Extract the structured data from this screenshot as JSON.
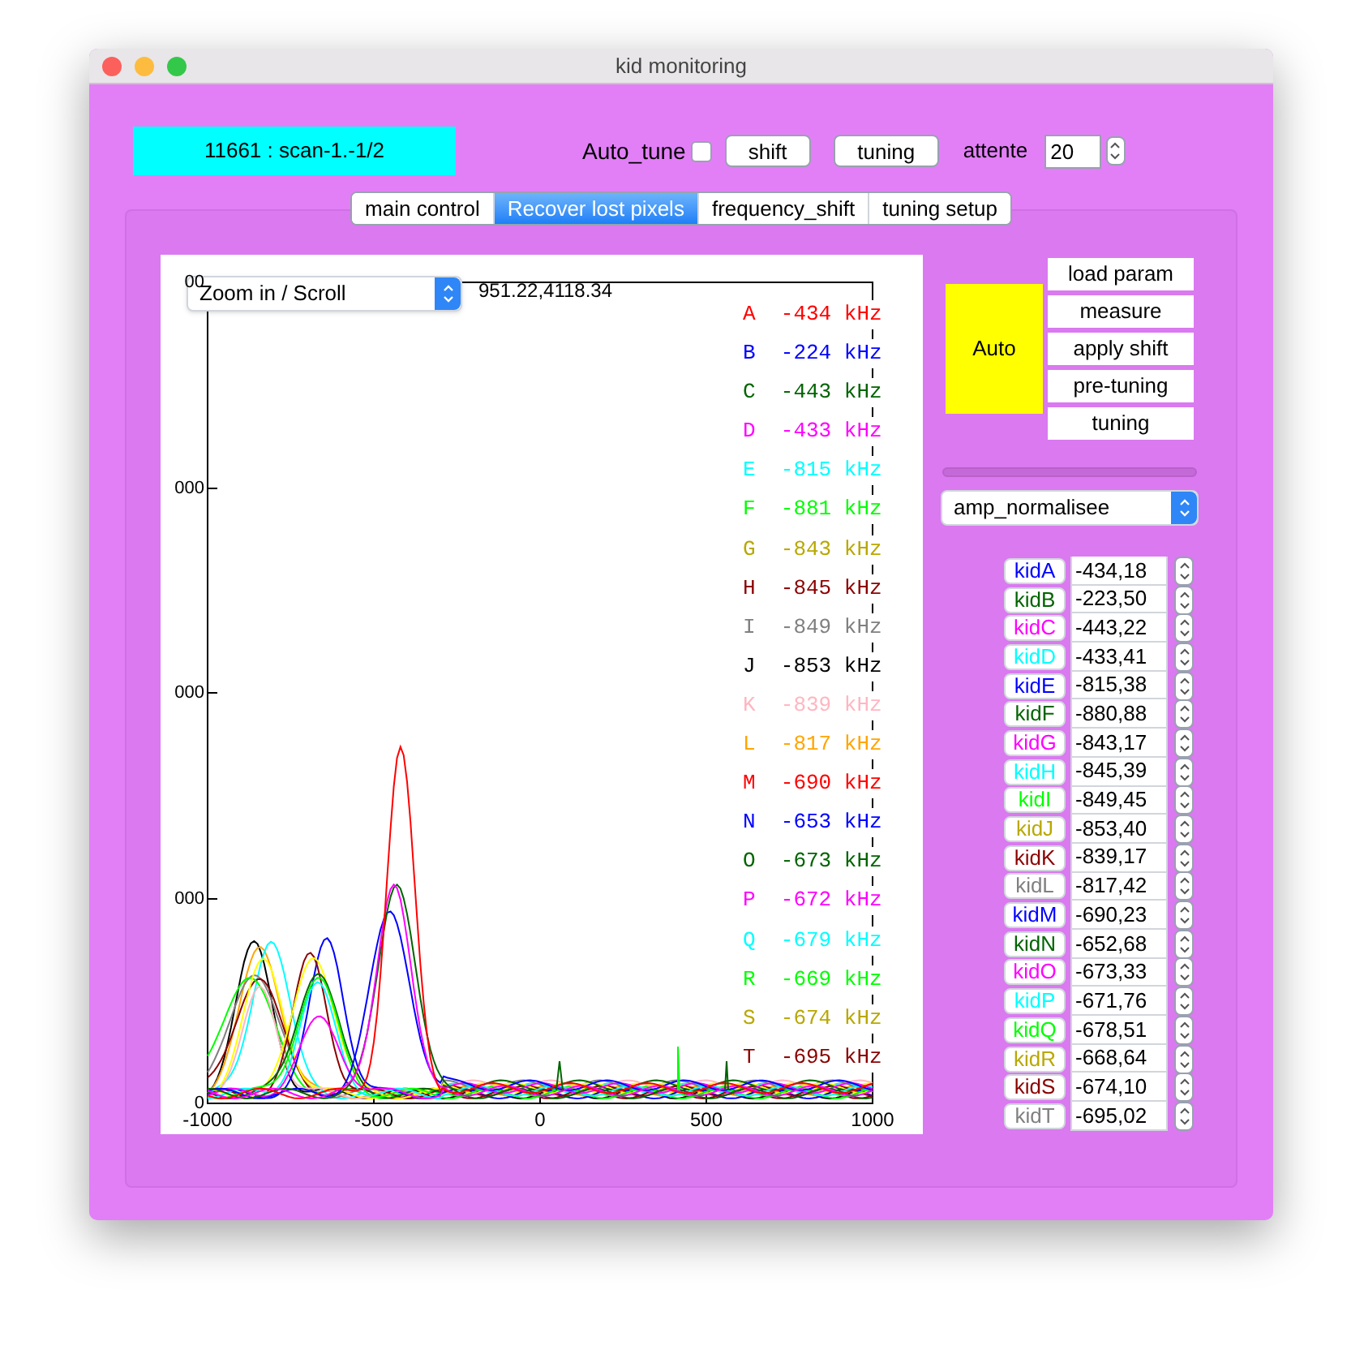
{
  "window": {
    "title": "kid monitoring"
  },
  "header": {
    "scan_label": "11661 : scan-1.-1/2",
    "auto_tune": {
      "label": "Auto_tune",
      "checked": false
    },
    "buttons": [
      "shift",
      "tuning"
    ],
    "attente": {
      "label": "attente",
      "value": "20"
    }
  },
  "tabs": [
    {
      "label": "main control",
      "selected": false
    },
    {
      "label": "Recover lost pixels",
      "selected": true
    },
    {
      "label": "frequency_shift",
      "selected": false
    },
    {
      "label": "tuning setup",
      "selected": false
    }
  ],
  "plot": {
    "mode_dropdown": "Zoom in / Scroll",
    "cursor_readout": "951.22,4118.34",
    "y_tick_labels": [
      "00",
      "000",
      "000",
      "000",
      "0"
    ],
    "x_tick_labels": [
      "-1000",
      "-500",
      "0",
      "500",
      "1000"
    ],
    "legend": [
      {
        "letter": "A",
        "value": "-434",
        "unit": "kHz",
        "color": "#ff0000"
      },
      {
        "letter": "B",
        "value": "-224",
        "unit": "kHz",
        "color": "#0000ff"
      },
      {
        "letter": "C",
        "value": "-443",
        "unit": "kHz",
        "color": "#006400"
      },
      {
        "letter": "D",
        "value": "-433",
        "unit": "kHz",
        "color": "#ff00ff"
      },
      {
        "letter": "E",
        "value": "-815",
        "unit": "kHz",
        "color": "#00ffff"
      },
      {
        "letter": "F",
        "value": "-881",
        "unit": "kHz",
        "color": "#00ff00"
      },
      {
        "letter": "G",
        "value": "-843",
        "unit": "kHz",
        "color": "#b8a800"
      },
      {
        "letter": "H",
        "value": "-845",
        "unit": "kHz",
        "color": "#8b0000"
      },
      {
        "letter": "I",
        "value": "-849",
        "unit": "kHz",
        "color": "#808080"
      },
      {
        "letter": "J",
        "value": "-853",
        "unit": "kHz",
        "color": "#000000"
      },
      {
        "letter": "K",
        "value": "-839",
        "unit": "kHz",
        "color": "#ffb6c1"
      },
      {
        "letter": "L",
        "value": "-817",
        "unit": "kHz",
        "color": "#ffa500"
      },
      {
        "letter": "M",
        "value": "-690",
        "unit": "kHz",
        "color": "#ff0000"
      },
      {
        "letter": "N",
        "value": "-653",
        "unit": "kHz",
        "color": "#0000ff"
      },
      {
        "letter": "O",
        "value": "-673",
        "unit": "kHz",
        "color": "#006400"
      },
      {
        "letter": "P",
        "value": "-672",
        "unit": "kHz",
        "color": "#ff00ff"
      },
      {
        "letter": "Q",
        "value": "-679",
        "unit": "kHz",
        "color": "#00ffff"
      },
      {
        "letter": "R",
        "value": "-669",
        "unit": "kHz",
        "color": "#00ff00"
      },
      {
        "letter": "S",
        "value": "-674",
        "unit": "kHz",
        "color": "#b8a800"
      },
      {
        "letter": "T",
        "value": "-695",
        "unit": "kHz",
        "color": "#8b0000"
      }
    ]
  },
  "controls": {
    "auto_button": "Auto",
    "buttons": [
      "load param",
      "measure",
      "apply shift",
      "pre-tuning",
      "tuning"
    ],
    "progress": {
      "level": 0
    },
    "mode_select": "amp_normalisee"
  },
  "kids": [
    {
      "label": "kidA",
      "value": "-434,18",
      "color": "#0000ff"
    },
    {
      "label": "kidB",
      "value": "-223,50",
      "color": "#006400"
    },
    {
      "label": "kidC",
      "value": "-443,22",
      "color": "#ff00ff"
    },
    {
      "label": "kidD",
      "value": "-433,41",
      "color": "#00ffff"
    },
    {
      "label": "kidE",
      "value": "-815,38",
      "color": "#0000ff"
    },
    {
      "label": "kidF",
      "value": "-880,88",
      "color": "#006400"
    },
    {
      "label": "kidG",
      "value": "-843,17",
      "color": "#ff00ff"
    },
    {
      "label": "kidH",
      "value": "-845,39",
      "color": "#00ffff"
    },
    {
      "label": "kidI",
      "value": "-849,45",
      "color": "#00ff00"
    },
    {
      "label": "kidJ",
      "value": "-853,40",
      "color": "#b8a800"
    },
    {
      "label": "kidK",
      "value": "-839,17",
      "color": "#8b0000"
    },
    {
      "label": "kidL",
      "value": "-817,42",
      "color": "#808080"
    },
    {
      "label": "kidM",
      "value": "-690,23",
      "color": "#0000ff"
    },
    {
      "label": "kidN",
      "value": "-652,68",
      "color": "#006400"
    },
    {
      "label": "kidO",
      "value": "-673,33",
      "color": "#ff00ff"
    },
    {
      "label": "kidP",
      "value": "-671,76",
      "color": "#00ffff"
    },
    {
      "label": "kidQ",
      "value": "-678,51",
      "color": "#00ff00"
    },
    {
      "label": "kidR",
      "value": "-668,64",
      "color": "#b8a800"
    },
    {
      "label": "kidS",
      "value": "-674,10",
      "color": "#8b0000"
    },
    {
      "label": "kidT",
      "value": "-695,02",
      "color": "#808080"
    }
  ]
}
